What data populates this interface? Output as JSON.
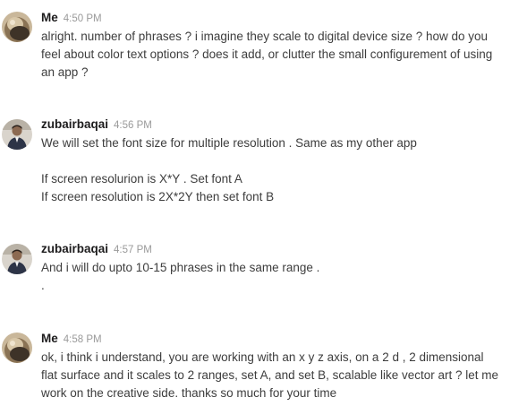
{
  "messages": [
    {
      "sender": "Me",
      "time": "4:50 PM",
      "avatar_icon": "photo-avatar-icon",
      "lines": [
        "alright. number of phrases ? i imagine they scale to digital device size ? how do you",
        "feel about color text options ? does it add, or clutter the small configurement of using",
        "an app ?"
      ]
    },
    {
      "sender": "zubairbaqai",
      "time": "4:56 PM",
      "avatar_icon": "person-avatar-icon",
      "lines": [
        "We will set the font size for multiple resolution . Same as my other app",
        "",
        "If screen resolurion is X*Y . Set font A",
        "If screen resolution is 2X*2Y then set font B"
      ]
    },
    {
      "sender": "zubairbaqai",
      "time": "4:57 PM",
      "avatar_icon": "person-avatar-icon",
      "lines": [
        "And i will do upto 10-15 phrases in the same range .",
        "."
      ]
    },
    {
      "sender": "Me",
      "time": "4:58 PM",
      "avatar_icon": "photo-avatar-icon",
      "lines": [
        "ok, i think i understand, you are working with an x y z axis, on a 2 d , 2 dimensional",
        "flat surface and it scales to 2 ranges, set A, and set B, scalable like vector art ? let me",
        "work on the creative side. thanks so much for your time"
      ]
    }
  ]
}
